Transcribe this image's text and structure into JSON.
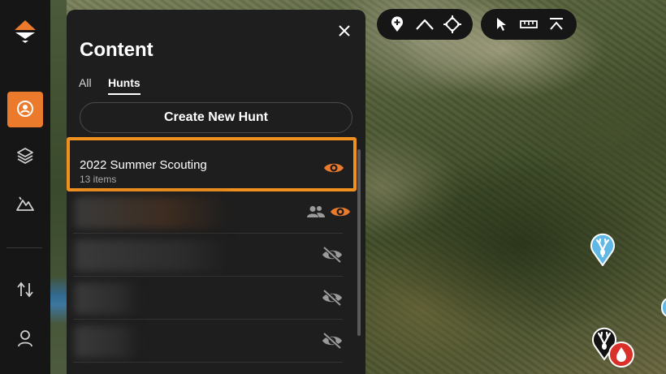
{
  "panel": {
    "title": "Content",
    "close_icon": "close-icon",
    "tabs": [
      {
        "label": "All",
        "active": false
      },
      {
        "label": "Hunts",
        "active": true
      }
    ],
    "create_button_label": "Create New Hunt",
    "hunts": [
      {
        "name": "2022 Summer Scouting",
        "count": "13 items",
        "visible": true,
        "highlighted": true
      },
      {
        "name": "",
        "count": "",
        "visible": true,
        "shared": true,
        "redacted": true
      },
      {
        "name": "",
        "count": "",
        "visible": false,
        "redacted": true
      },
      {
        "name": "",
        "count": "",
        "visible": false,
        "redacted": true
      },
      {
        "name": "",
        "count": "",
        "visible": false,
        "redacted": true
      }
    ]
  },
  "left_nav": {
    "logo_icon": "gohunt-logo-icon",
    "items": [
      {
        "icon": "location-pin-icon",
        "active": true
      },
      {
        "icon": "layers-icon",
        "active": false
      },
      {
        "icon": "terrain-icon",
        "active": false
      },
      {
        "icon": "sort-arrows-icon",
        "active": false
      },
      {
        "icon": "user-icon",
        "active": false
      }
    ]
  },
  "map_toolbar_draw": [
    "add-waypoint-icon",
    "draw-line-icon",
    "crosshair-icon"
  ],
  "map_toolbar_tools": [
    "cursor-icon",
    "measure-icon",
    "elevation-profile-icon"
  ],
  "map_markers": [
    "deer-marker-blue",
    "deer-marker-black",
    "drop-marker-red"
  ],
  "colors": {
    "accent": "#ec7a2c",
    "highlight": "#f0901e",
    "panel_bg": "#1e1e1e",
    "nav_bg": "#161616",
    "marker_blue": "#5fb8e6",
    "marker_red": "#d9302a"
  }
}
